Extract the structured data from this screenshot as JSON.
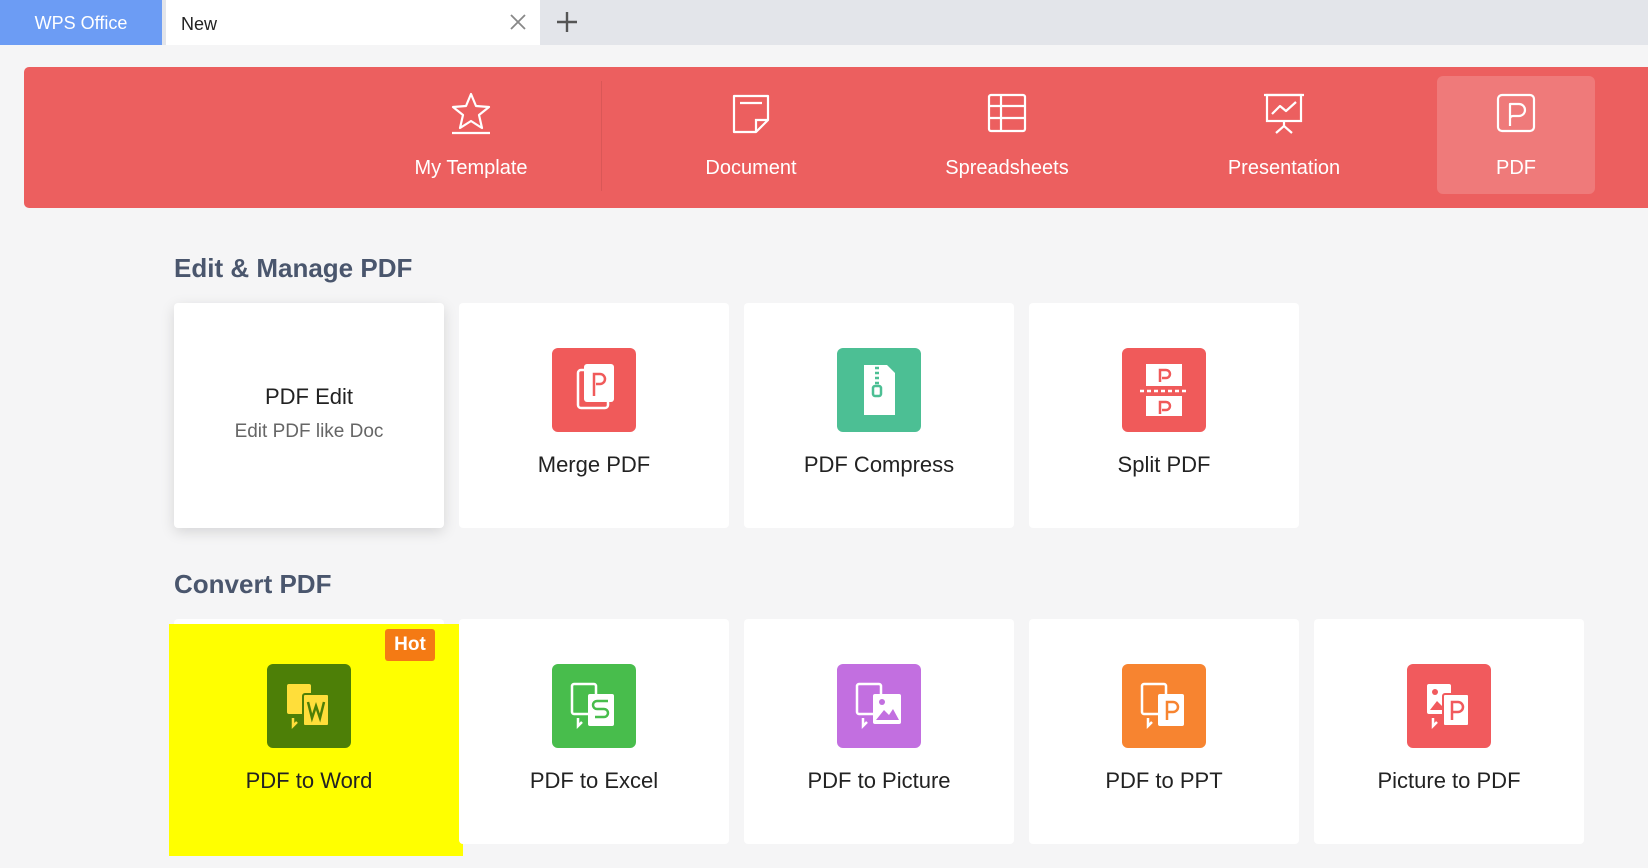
{
  "tabs": {
    "app_label": "WPS Office",
    "document_label": "New"
  },
  "categories": [
    {
      "label": "My Template",
      "icon": "star-icon"
    },
    {
      "label": "Document",
      "icon": "document-icon"
    },
    {
      "label": "Spreadsheets",
      "icon": "spreadsheet-icon"
    },
    {
      "label": "Presentation",
      "icon": "presentation-icon"
    },
    {
      "label": "PDF",
      "icon": "pdf-icon",
      "active": true
    }
  ],
  "sections": {
    "edit": {
      "title": "Edit & Manage PDF",
      "cards": [
        {
          "title": "PDF Edit",
          "subtitle": "Edit PDF like Doc"
        },
        {
          "title": "Merge PDF",
          "color": "#f05a5a",
          "icon": "merge-pdf-icon"
        },
        {
          "title": "PDF Compress",
          "color": "#4cbf94",
          "icon": "compress-icon"
        },
        {
          "title": "Split PDF",
          "color": "#f05a5a",
          "icon": "split-pdf-icon"
        }
      ]
    },
    "convert": {
      "title": "Convert PDF",
      "cards": [
        {
          "title": "PDF to Word",
          "color": "#4d7f07",
          "icon": "pdf-to-word-icon",
          "badge": "Hot"
        },
        {
          "title": "PDF to Excel",
          "color": "#48bd4c",
          "icon": "pdf-to-excel-icon"
        },
        {
          "title": "PDF to Picture",
          "color": "#c26fe0",
          "icon": "pdf-to-picture-icon"
        },
        {
          "title": "PDF to PPT",
          "color": "#f78430",
          "icon": "pdf-to-ppt-icon"
        },
        {
          "title": "Picture to PDF",
          "color": "#f15a5d",
          "icon": "picture-to-pdf-icon"
        }
      ]
    }
  },
  "colors": {
    "banner": "#ec5f5f",
    "app_tab": "#6c9cf4",
    "highlight": "#ffff00",
    "hot_badge": "#f47a14"
  }
}
